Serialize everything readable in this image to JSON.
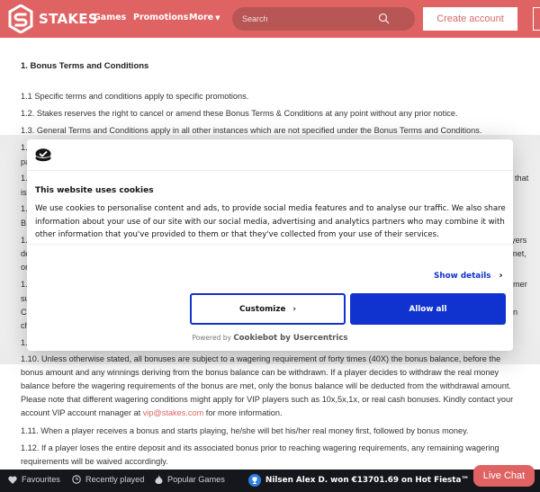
{
  "header": {
    "brand": "STAKES",
    "nav": [
      {
        "label": "Games"
      },
      {
        "label": "Promotions"
      },
      {
        "label": "More"
      }
    ],
    "search_placeholder": "Search",
    "create_account": "Create account",
    "brand_color": "#e06363"
  },
  "content": {
    "heading": "1. Bonus Terms and Conditions",
    "p1_1": "1.1 Specific terms and conditions apply to specific promotions.",
    "p1_2": "1.2. Stakes reserves the right to cancel or amend these Bonus Terms & Conditions at any point without any prior notice.",
    "p1_3": "1.3. General Terms and Conditions apply in all other instances which are not specified under the Bonus Terms and Conditions.",
    "partial_left": [
      "1.",
      "pa",
      "1.",
      "is",
      "1.",
      "B",
      "1.",
      "de",
      "or",
      "1.",
      "su",
      "C",
      "ch",
      "1."
    ],
    "partial_right": [
      "that",
      "yers",
      "met,",
      "mer",
      "n"
    ],
    "p1_10_pre": "1.10. Unless otherwise stated, all bonuses are subject to a wagering requirement of forty times (40X) the bonus balance, before the bonus amount and any winnings deriving from the bonus balance can be withdrawn.  If a player decides to withdraw the real money balance before the wagering requirements of the bonus are met, only the bonus balance will be deducted from the withdrawal amount. Please note that different wagering conditions might apply for VIP players such as 10x,5x,1x, or real cash bonuses. Kindly contact your account VIP account manager at ",
    "p1_10_link": "vip@stakes.com",
    "p1_10_post": " for more information.",
    "p1_11": "1.11. When a player receives a bonus and starts playing, he/she will bet his/her real money first, followed by bonus money.",
    "p1_12": "1.12.  If a player loses the entire deposit and its associated bonus prior to reaching wagering requirements, any remaining wagering requirements will be waived accordingly."
  },
  "cookie": {
    "title": "This website uses cookies",
    "body": "We use cookies to personalise content and ads, to provide social media features and to analyse our traffic. We also share information about your use of our site with our social media, advertising and analytics partners who may combine it with other information that you've provided to them or that they've collected from your use of their services.",
    "show_details": "Show details",
    "customize": "Customize",
    "allow_all": "Allow all",
    "powered_prefix": "Powered by",
    "powered_brand": "Cookiebot by Usercentrics",
    "accent_color": "#1032cf"
  },
  "bottombar": {
    "favourites": "Favourites",
    "recently_played": "Recently played",
    "popular_games": "Popular Games",
    "winner_ticker": "Nilsen Alex D. won €13701.69 on Hot Fiesta™",
    "live_chat": "Live Chat"
  }
}
